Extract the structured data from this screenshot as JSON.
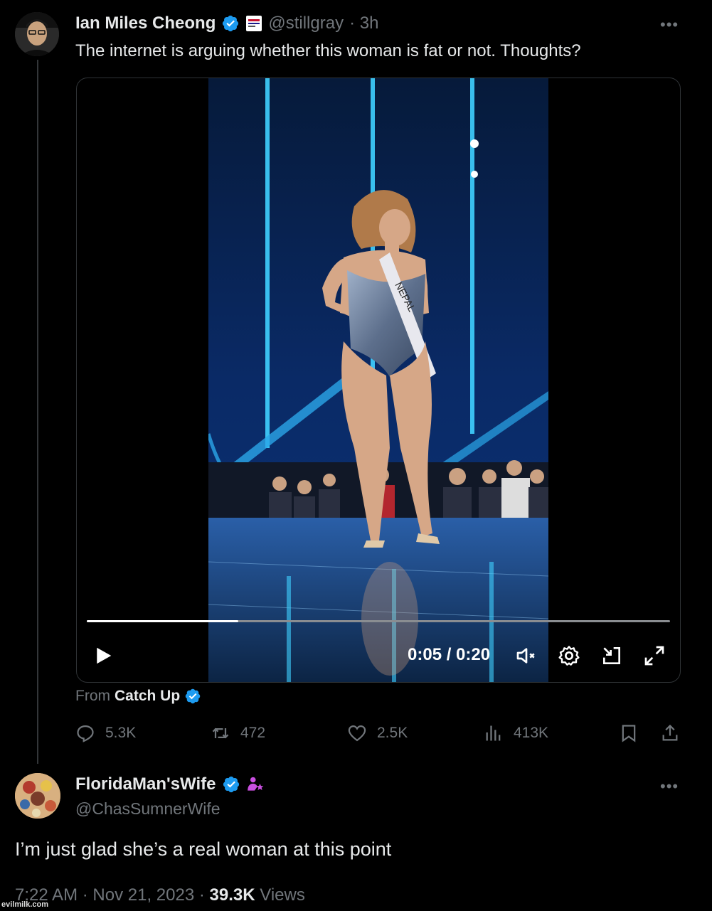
{
  "tweet": {
    "author_name": "Ian Miles Cheong",
    "author_handle": "@stillgray",
    "time_ago": "· 3h",
    "text": "The internet is arguing whether this woman is fat or not. Thoughts?",
    "more_label": "•••",
    "video": {
      "current_time": "0:05",
      "duration": "0:20",
      "time_display": "0:05 / 0:20",
      "progress_fraction": 0.26,
      "sash_text": "NEPAL"
    },
    "source_prefix": "From",
    "source_name": "Catch Up",
    "actions": {
      "replies": "5.3K",
      "reposts": "472",
      "likes": "2.5K",
      "views": "413K"
    }
  },
  "reply": {
    "author_name": "FloridaMan'sWife",
    "author_handle": "@ChasSumnerWife",
    "text": "I’m just glad she’s a real woman at this point",
    "more_label": "•••",
    "time": "7:22 AM",
    "date": "Nov 21, 2023",
    "views_count": "39.3K",
    "views_label": "Views"
  },
  "watermark": "evilmilk.com",
  "colors": {
    "background": "#000000",
    "text_primary": "#e7e9ea",
    "text_secondary": "#71767b",
    "verified_blue": "#1d9bf0",
    "subscriber_purple": "#c94fe0"
  }
}
